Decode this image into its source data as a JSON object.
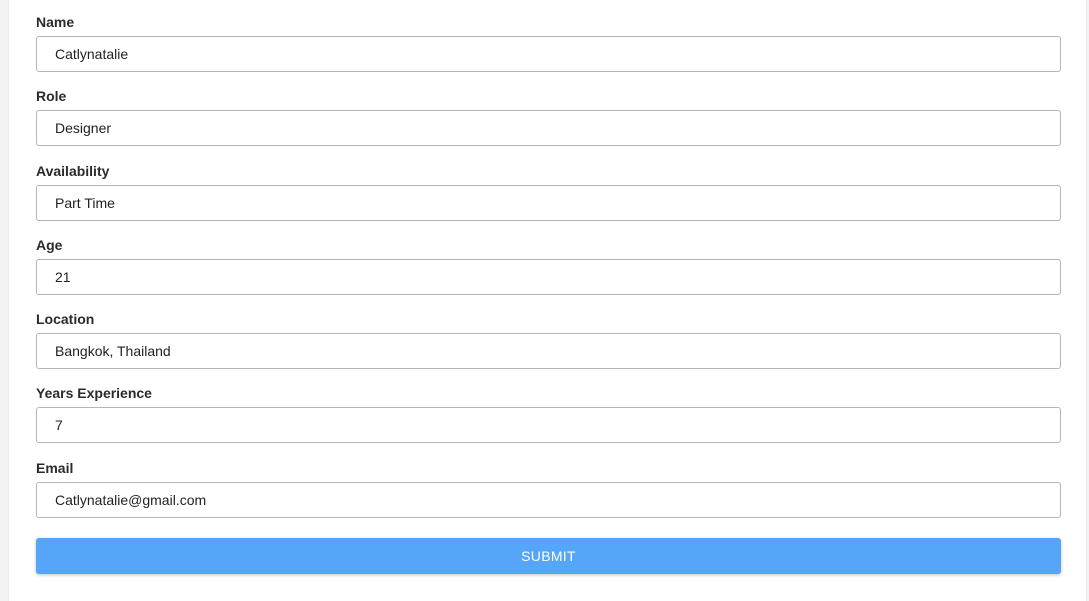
{
  "form": {
    "fields": [
      {
        "label": "Name",
        "value": "Catlynatalie"
      },
      {
        "label": "Role",
        "value": "Designer"
      },
      {
        "label": "Availability",
        "value": "Part Time"
      },
      {
        "label": "Age",
        "value": "21"
      },
      {
        "label": "Location",
        "value": "Bangkok, Thailand"
      },
      {
        "label": "Years Experience",
        "value": "7"
      },
      {
        "label": "Email",
        "value": "Catlynatalie@gmail.com"
      }
    ],
    "submit_label": "SUBMIT"
  },
  "colors": {
    "submit_background": "#55a6f8",
    "input_border": "#b5b5b5",
    "label_text": "#2b2b2b"
  }
}
